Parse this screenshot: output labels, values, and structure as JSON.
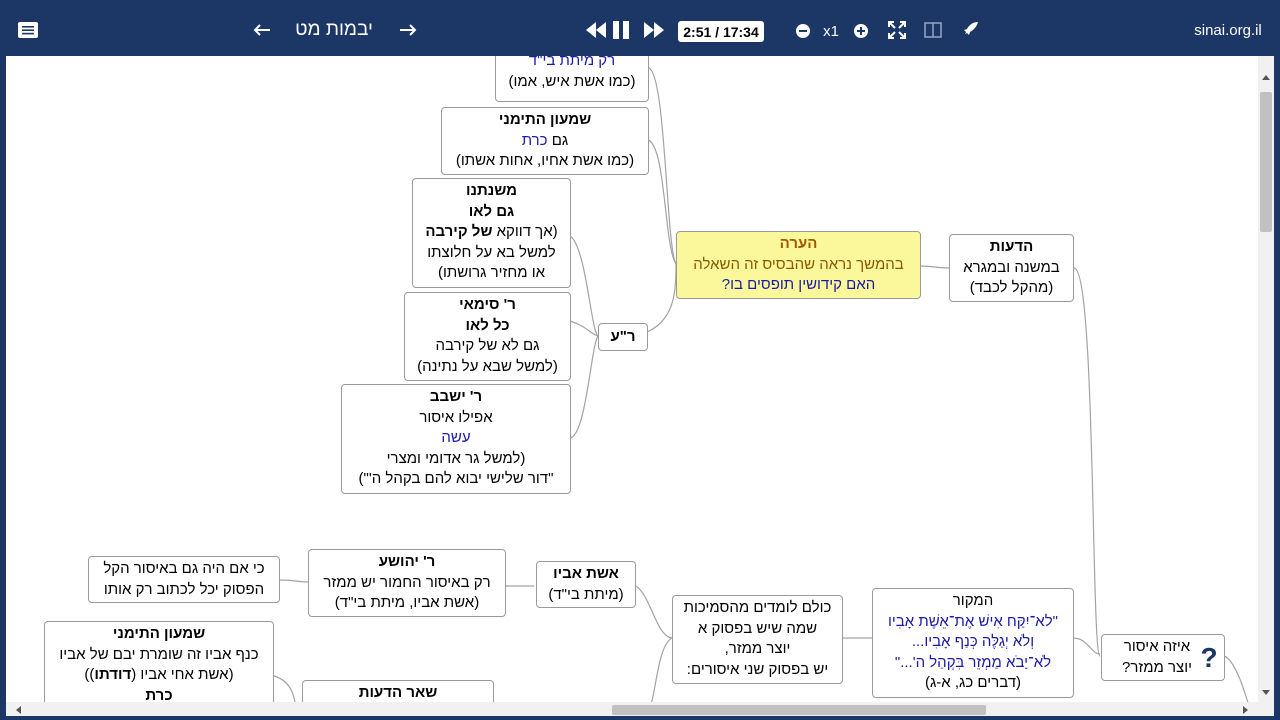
{
  "toolbar": {
    "title": "יבמות מט",
    "time": "2:51 / 17:34",
    "speed": "x1",
    "site": "sinai.org.il"
  },
  "colors": {
    "bar": "#1c3766",
    "highlight": "#fbf79b",
    "blue_text": "#1a1aa6"
  },
  "nodes": {
    "top_cut": {
      "l1": "רק מיתת בי\"ד",
      "l2": "(כמו אשת איש, אמו)"
    },
    "shimon1": {
      "l1": "שמעון התימני",
      "l2a": "גם ",
      "l2b": "כרת",
      "l3": "(כמו אשת אחיו, אחות אשתו)"
    },
    "mishnatenu": {
      "l1": "משנתנו",
      "l2": "גם לאו",
      "l3a": "(אך דווקא ",
      "l3b": "של קירבה",
      "l4": "למשל בא על חלוצתו",
      "l5": "או מחזיר גרושתו)"
    },
    "simai": {
      "l1": "ר' סימאי",
      "l2": "כל לאו",
      "l3": "גם לא של קירבה",
      "l4": "(למשל שבא על נתינה)"
    },
    "yeshevav": {
      "l1": "ר' ישבב",
      "l2": "אפילו איסור",
      "l3": "עשה",
      "l4": "(למשל גר אדומי ומצרי",
      "l5": "\"דור שלישי יבוא להם בקהל ה'\")"
    },
    "ra": {
      "l1": "ר\"ע"
    },
    "note": {
      "l1": "הערה",
      "l2": "בהמשך נראה שהבסיס זה השאלה",
      "l3": "האם קידושין תופסים בו?"
    },
    "deot": {
      "l1": "הדעות",
      "l2": "במשנה ובמגרא",
      "l3": "(מהקל לכבד)"
    },
    "kiim": {
      "l1": "כי אם היה גם באיסור הקל",
      "l2": "הפסוק יכל לכתוב רק אותו"
    },
    "yehoshua": {
      "l1": "ר' יהושע",
      "l2": "רק באיסור החמור יש ממזר",
      "l3": "(אשת אביו, מיתת בי\"ד)"
    },
    "eshet": {
      "l1": "אשת אביו",
      "l2": "(מיתת בי\"ד)"
    },
    "kulam": {
      "l1": "כולם לומדים מהסמיכות",
      "l2": "שמה שיש בפסוק א",
      "l3": "יוצר ממזר,",
      "l4": "יש בפסוק שני איסורים:"
    },
    "makor": {
      "l1": "המקור",
      "l2": "\"לא־יִקַּח אִישׁ אֶת־אֵשֶׁת אָבִיו",
      "l3": "וְלֹא יְגַלֶּה כְּנַף אָבִיו...",
      "l4": "לֹא־יָבֹא מַמְזֵר בִּקְהַל ה'...\"",
      "l5": "(דברים כג, א-ג)"
    },
    "question": {
      "l1": "איזה איסור",
      "l2": "יוצר ממזר?",
      "icon": "?"
    },
    "shimon2": {
      "l1": "שמעון התימני",
      "l2": "כנף אביו זה שומרת יבם של אביו",
      "l3a": "(אשת אחי אביו (",
      "l3b": "דודתו",
      "l3c": "))",
      "l4": "כרת"
    },
    "shear": {
      "l1": "שאר הדעות"
    }
  }
}
